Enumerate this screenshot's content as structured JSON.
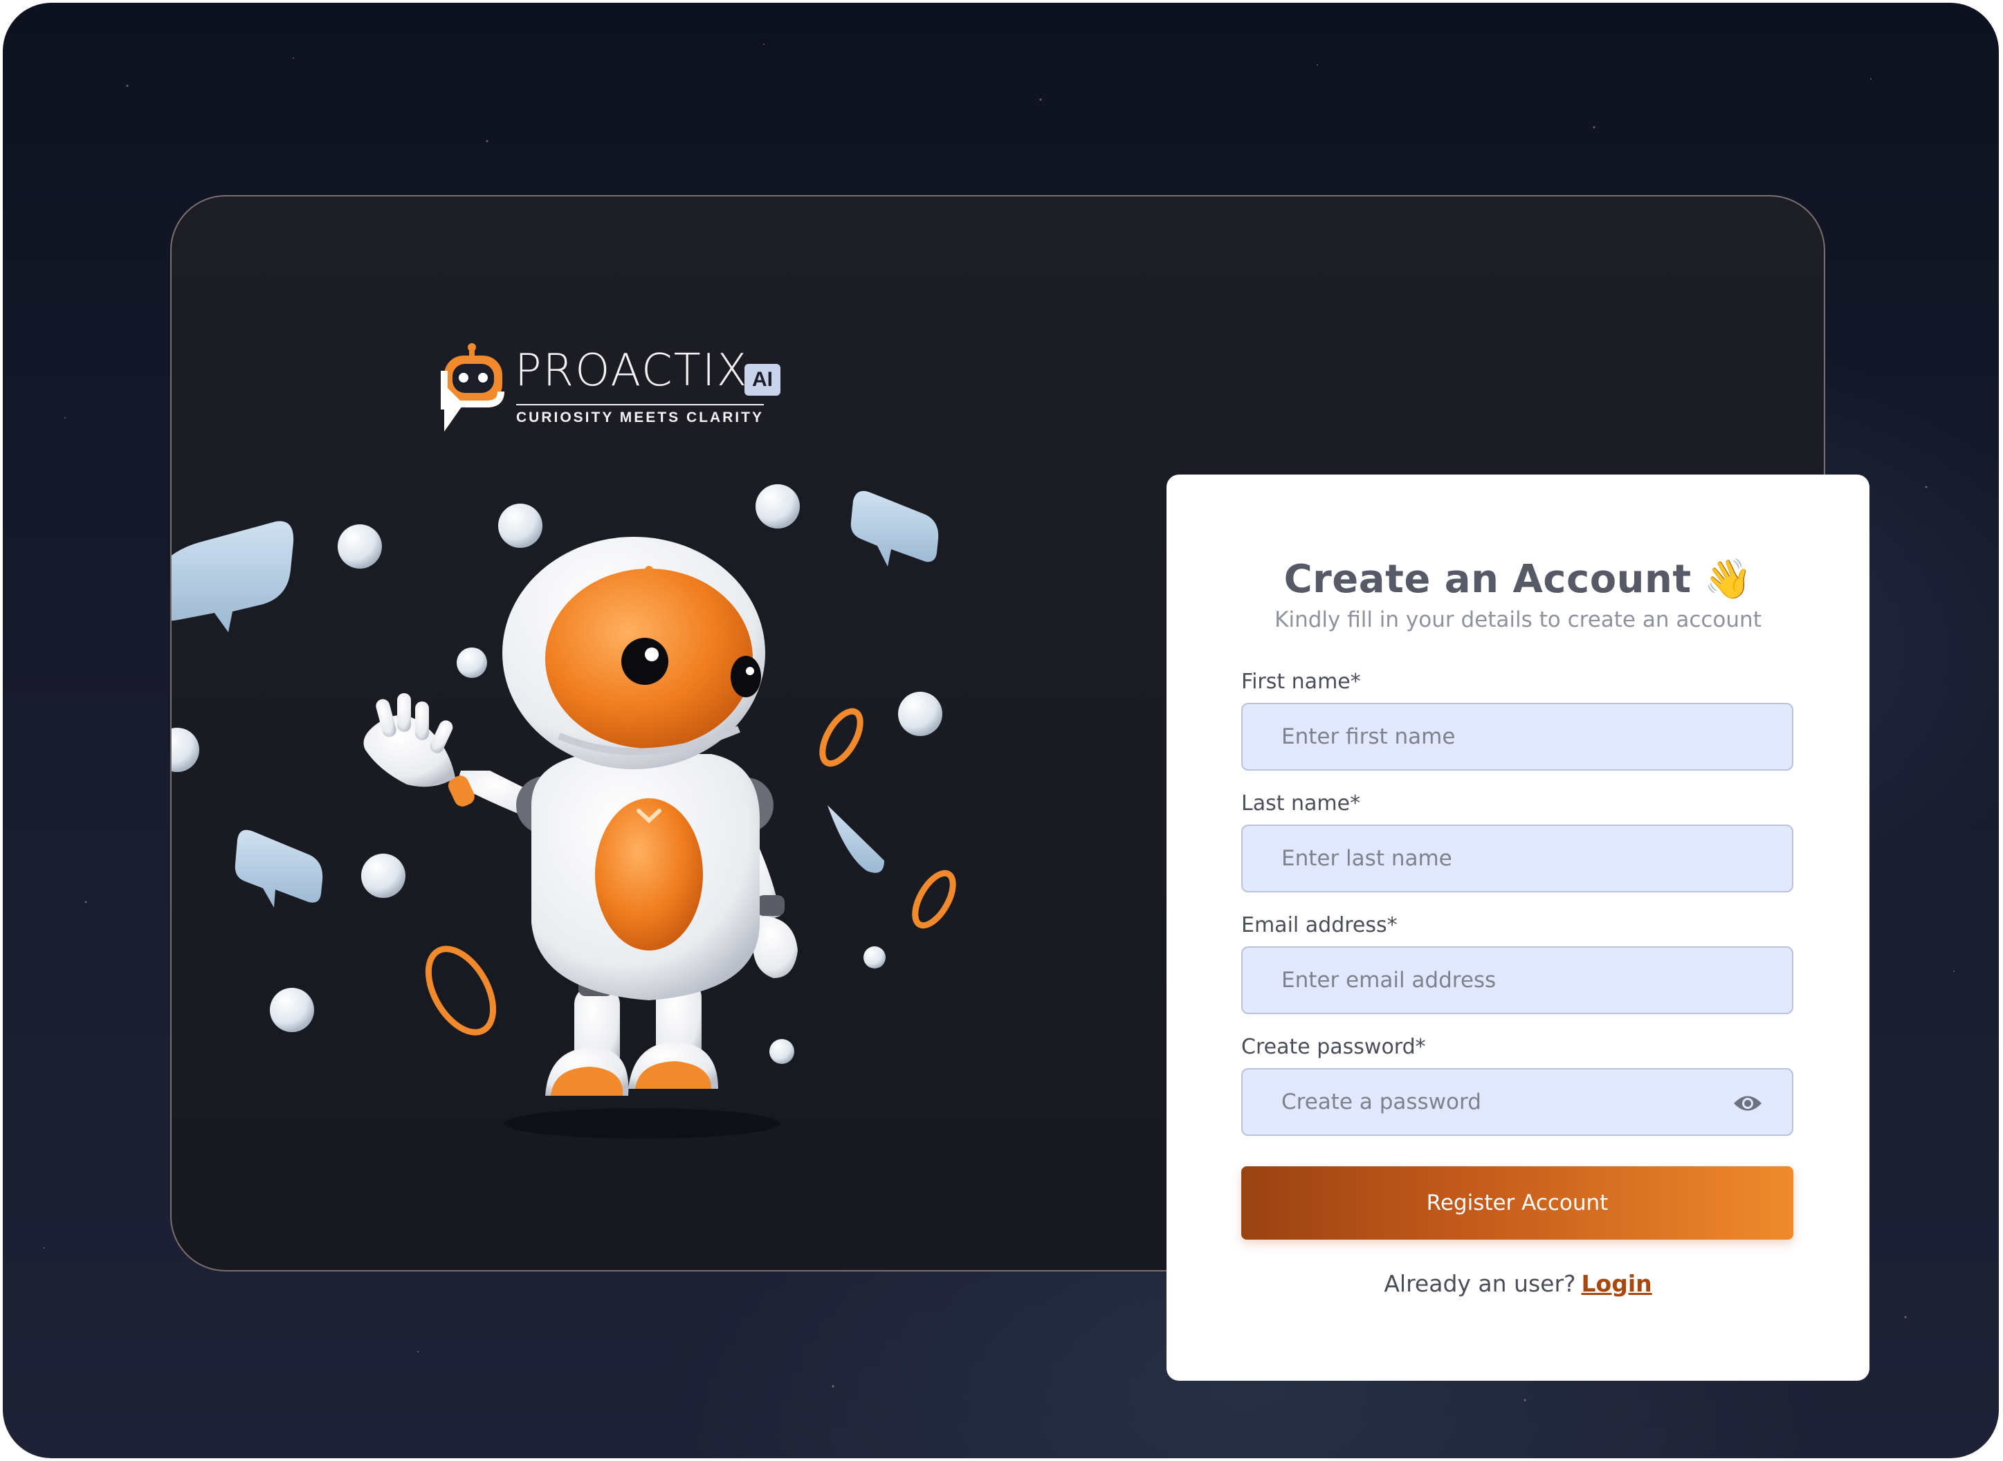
{
  "brand": {
    "name": "PROACTIX",
    "badge": "AI",
    "tagline": "CURIOSITY MEETS CLARITY"
  },
  "form": {
    "title": "Create an Account",
    "title_emoji": "👋",
    "subtitle": "Kindly fill in your details to create an account",
    "fields": {
      "first_name": {
        "label": "First name*",
        "placeholder": "Enter first name",
        "value": ""
      },
      "last_name": {
        "label": "Last name*",
        "placeholder": "Enter last name",
        "value": ""
      },
      "email": {
        "label": "Email address*",
        "placeholder": "Enter email address",
        "value": ""
      },
      "password": {
        "label": "Create password*",
        "placeholder": "Create a password",
        "value": ""
      }
    },
    "submit_label": "Register Account",
    "login_prompt": "Already an user?",
    "login_link": "Login"
  },
  "colors": {
    "accent_orange": "#f08a2c",
    "accent_dark_orange": "#9a4212",
    "input_bg": "#e2e8fd",
    "panel_bg": "#171820",
    "page_bg": "#0e1220"
  },
  "icons": {
    "password_toggle": "eye-icon",
    "title_wave": "waving-hand-icon"
  }
}
